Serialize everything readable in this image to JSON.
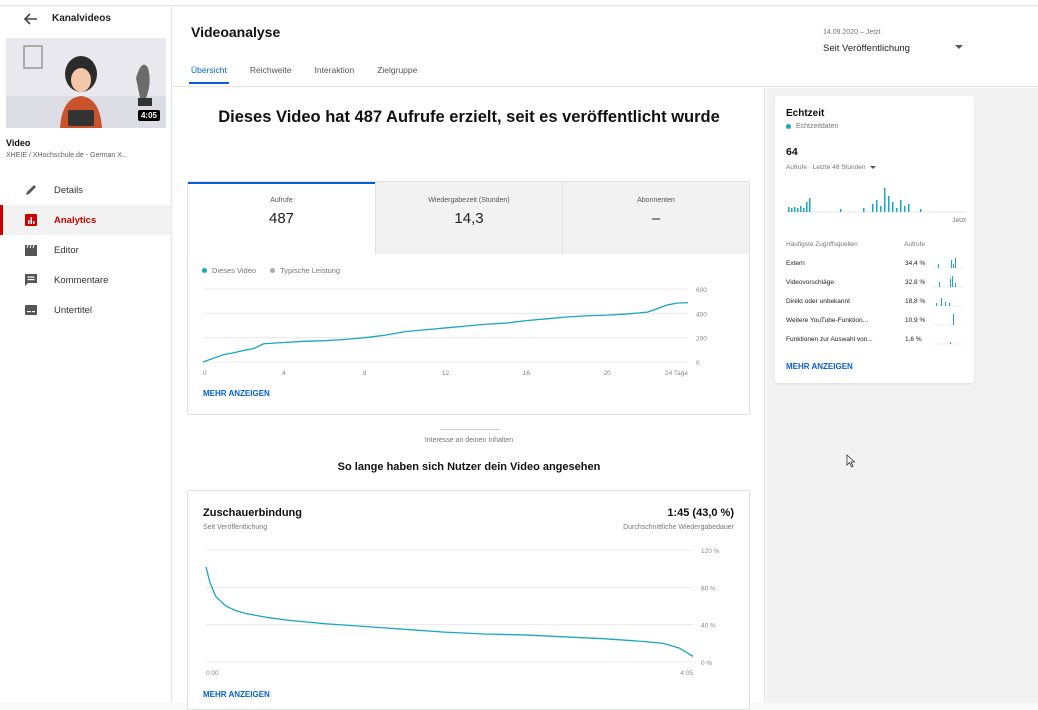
{
  "sidebar": {
    "title": "Kanalvideos",
    "thumbnail_duration": "4:05",
    "video_label": "Video",
    "channel": "XHEIE / XHochschule.de - German X...",
    "nav": [
      {
        "label": "Details",
        "icon": "pencil-icon",
        "active": false
      },
      {
        "label": "Analytics",
        "icon": "analytics-icon",
        "active": true
      },
      {
        "label": "Editor",
        "icon": "clapper-icon",
        "active": false
      },
      {
        "label": "Kommentare",
        "icon": "comment-icon",
        "active": false
      },
      {
        "label": "Untertitel",
        "icon": "subtitles-icon",
        "active": false
      }
    ]
  },
  "header": {
    "title": "Videoanalyse",
    "tabs": [
      {
        "label": "Übersicht",
        "active": true
      },
      {
        "label": "Reichweite",
        "active": false
      },
      {
        "label": "Interaktion",
        "active": false
      },
      {
        "label": "Zielgruppe",
        "active": false
      }
    ],
    "date_range": "14.09.2020 – Jetzt",
    "date_selection": "Seit Veröffentlichung"
  },
  "main": {
    "headline": "Dieses Video hat 487 Aufrufe erzielt, seit es veröffentlicht wurde",
    "metrics": [
      {
        "label": "Aufrufe",
        "value": "487"
      },
      {
        "label": "Wiedergabezeit (Stunden)",
        "value": "14,3"
      },
      {
        "label": "Abonnenten",
        "value": "–"
      }
    ],
    "legend": {
      "this_video": "Dieses Video",
      "typical": "Typische Leistung"
    },
    "more_label": "MEHR ANZEIGEN",
    "section_sub": "Interesse an deinen Inhalten",
    "section_title": "So lange haben sich Nutzer dein Video angesehen",
    "retention": {
      "title": "Zuschauerbindung",
      "subtitle": "Seit Veröffentlichung",
      "value": "1:45 (43,0 %)",
      "value_sub": "Durchschnittliche Wiedergabedauer"
    }
  },
  "realtime": {
    "title": "Echtzeit",
    "live_label": "Echtzeitdaten",
    "count": "64",
    "count_sub": "Aufrufe · Letzte 48 Stunden",
    "now_label": "Jetzt",
    "sources_header": "Häufigste Zugriffsquellen",
    "views_header": "Aufrufe",
    "sources": [
      {
        "name": "Extern",
        "pct": "34,4 %"
      },
      {
        "name": "Videovorschläge",
        "pct": "32,8 %"
      },
      {
        "name": "Direkt oder unbekannt",
        "pct": "18,8 %"
      },
      {
        "name": "Weitere YouTube-Funktion...",
        "pct": "10,9 %"
      },
      {
        "name": "Funktionen zur Auswahl von...",
        "pct": "1,6 %"
      }
    ],
    "more_label": "MEHR ANZEIGEN"
  },
  "colors": {
    "accent": "#065fd4",
    "series": "#1aa6c3",
    "active_nav": "#cc0000"
  },
  "chart_data": [
    {
      "type": "line",
      "title": "",
      "xlabel": "",
      "ylabel": "",
      "x_ticks": [
        "0",
        "4",
        "8",
        "12",
        "16",
        "20",
        "24 Tage"
      ],
      "y_ticks": [
        "600",
        "400",
        "200",
        "0"
      ],
      "xlim": [
        0,
        24
      ],
      "ylim": [
        0,
        600
      ],
      "series": [
        {
          "name": "Dieses Video",
          "x": [
            0,
            0.5,
            1,
            1.5,
            2,
            2.5,
            3,
            4,
            5,
            6,
            7,
            8,
            9,
            10,
            11,
            12,
            13,
            14,
            15,
            16,
            17,
            18,
            19,
            20,
            21,
            22,
            22.5,
            23,
            23.5,
            24
          ],
          "y": [
            0,
            30,
            60,
            75,
            95,
            110,
            150,
            160,
            170,
            175,
            185,
            200,
            220,
            250,
            265,
            280,
            295,
            310,
            320,
            340,
            355,
            370,
            380,
            385,
            395,
            410,
            440,
            470,
            485,
            487
          ]
        }
      ]
    },
    {
      "type": "line",
      "title": "Zuschauerbindung",
      "x_ticks": [
        "0:00",
        "4:05"
      ],
      "y_ticks": [
        "120 %",
        "80 %",
        "40 %",
        "0 %"
      ],
      "xlim": [
        0,
        245
      ],
      "ylim": [
        0,
        120
      ],
      "series": [
        {
          "name": "",
          "x": [
            0,
            2,
            5,
            10,
            15,
            20,
            30,
            40,
            60,
            80,
            100,
            120,
            140,
            160,
            180,
            200,
            220,
            230,
            238,
            242,
            245
          ],
          "y": [
            102,
            85,
            70,
            60,
            55,
            52,
            48,
            45,
            41,
            38,
            35,
            32,
            30,
            29,
            27,
            25,
            22,
            20,
            15,
            10,
            6
          ]
        }
      ]
    }
  ]
}
